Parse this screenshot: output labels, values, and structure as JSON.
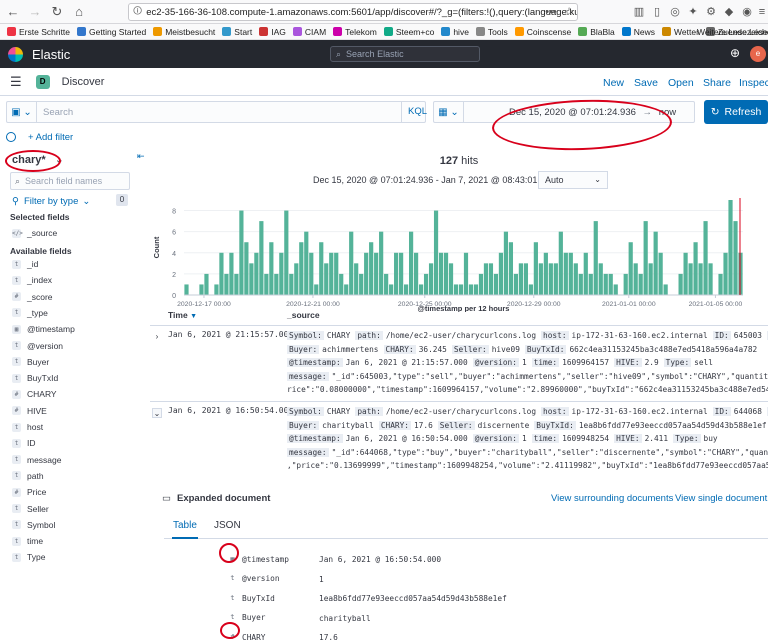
{
  "browser": {
    "url": "ec2-35-166-36-108.compute-1.amazonaws.com:5601/app/discover#/?_g=(filters:!(),query:(language:kue",
    "bookmarks": [
      "Erste Schritte",
      "Getting Started",
      "Meistbesucht",
      "Start",
      "IAG",
      "CIAM",
      "Telekom",
      "Steem+co",
      "hive",
      "Tools",
      "Coinscense",
      "BlaBla",
      "News",
      "Wetter",
      "Zuende Lesen"
    ],
    "other_bookmarks": "Weitere Lesezeichen"
  },
  "kibana": {
    "brand": "Elastic",
    "search_placeholder": "Search Elastic"
  },
  "app": {
    "badge": "D",
    "title": "Discover",
    "actions": [
      "New",
      "Save",
      "Open",
      "Share",
      "Inspect"
    ]
  },
  "query": {
    "placeholder": "Search",
    "language": "KQL",
    "range_start": "Dec 15, 2020 @ 07:01:24.936",
    "arrow": "→",
    "range_end": "now",
    "refresh": "Refresh",
    "add_filter": "+ Add filter"
  },
  "sidebar": {
    "index_pattern": "chary*",
    "field_search_placeholder": "Search field names",
    "filter_by_type": "Filter by type",
    "filter_count": "0",
    "selected_header": "Selected fields",
    "selected": [
      {
        "token": "</>",
        "name": "_source"
      }
    ],
    "available_header": "Available fields",
    "available": [
      {
        "token": "t",
        "name": "_id"
      },
      {
        "token": "t",
        "name": "_index"
      },
      {
        "token": "#",
        "name": "_score"
      },
      {
        "token": "t",
        "name": "_type"
      },
      {
        "token": "▦",
        "name": "@timestamp"
      },
      {
        "token": "t",
        "name": "@version"
      },
      {
        "token": "t",
        "name": "Buyer"
      },
      {
        "token": "t",
        "name": "BuyTxId"
      },
      {
        "token": "#",
        "name": "CHARY"
      },
      {
        "token": "#",
        "name": "HIVE"
      },
      {
        "token": "t",
        "name": "host"
      },
      {
        "token": "t",
        "name": "ID"
      },
      {
        "token": "t",
        "name": "message"
      },
      {
        "token": "t",
        "name": "path"
      },
      {
        "token": "#",
        "name": "Price"
      },
      {
        "token": "t",
        "name": "Seller"
      },
      {
        "token": "t",
        "name": "Symbol"
      },
      {
        "token": "t",
        "name": "time"
      },
      {
        "token": "t",
        "name": "Type"
      }
    ]
  },
  "results": {
    "hits_count": "127",
    "hits_label": "hits",
    "range": "Dec 15, 2020 @ 07:01:24.936 - Jan 7, 2021 @ 08:43:01.513",
    "interval": "Auto",
    "col_time": "Time",
    "col_source": "_source"
  },
  "chart_data": {
    "type": "bar",
    "title": "",
    "xlabel": "@timestamp per 12 hours",
    "ylabel": "Count",
    "ylim": [
      0,
      9
    ],
    "yticks": [
      0,
      2,
      4,
      6,
      8
    ],
    "xtick_labels": [
      "2020-12-17 00:00",
      "2020-12-21 00:00",
      "2020-12-25 00:00",
      "2020-12-29 00:00",
      "2021-01-01 00:00",
      "2021-01-05 00:00"
    ],
    "color": "#54b399",
    "values": [
      1,
      0,
      0,
      1,
      2,
      0,
      1,
      4,
      2,
      4,
      2,
      8,
      5,
      3,
      4,
      7,
      2,
      5,
      2,
      4,
      8,
      2,
      3,
      5,
      6,
      4,
      1,
      5,
      3,
      4,
      4,
      2,
      1,
      6,
      3,
      2,
      4,
      5,
      4,
      6,
      2,
      1,
      4,
      4,
      1,
      6,
      4,
      1,
      2,
      3,
      8,
      4,
      4,
      3,
      1,
      1,
      4,
      1,
      1,
      2,
      3,
      3,
      2,
      4,
      6,
      5,
      2,
      3,
      3,
      1,
      5,
      3,
      4,
      3,
      3,
      6,
      4,
      4,
      3,
      2,
      4,
      2,
      7,
      3,
      2,
      2,
      1,
      0,
      2,
      5,
      3,
      2,
      7,
      3,
      6,
      4,
      1,
      0,
      0,
      2,
      4,
      3,
      5,
      3,
      7,
      3,
      0,
      2,
      4,
      9,
      7,
      4
    ]
  },
  "rows": [
    {
      "time": "Jan 6, 2021 @ 21:15:57.000",
      "expander": "›",
      "pairs": [
        [
          [
            "Symbol:",
            "CHARY"
          ],
          [
            "path:",
            "/home/ec2-user/charycurlcons.log"
          ],
          [
            "host:",
            "ip-172-31-63-160.ec2.internal"
          ],
          [
            "ID:",
            "645003"
          ],
          [
            "Price:",
            "0.08"
          ]
        ],
        [
          [
            "Buyer:",
            "achimmertens"
          ],
          [
            "CHARY:",
            "36.245"
          ],
          [
            "Seller:",
            "hive09"
          ],
          [
            "BuyTxId:",
            "662c4ea31153245ba3c488e7ed5418a596a4a782"
          ]
        ],
        [
          [
            "@timestamp:",
            "Jan 6, 2021 @ 21:15:57.000"
          ],
          [
            "@version:",
            "1"
          ],
          [
            "time:",
            "1609964157"
          ],
          [
            "HIVE:",
            "2.9"
          ],
          [
            "Type:",
            "sell"
          ]
        ],
        [
          [
            "message:",
            "\"_id\":645003,\"type\":\"sell\",\"buyer\":\"achimmertens\",\"seller\":\"hive09\",\"symbol\":\"CHARY\",\"quantity\":\"36.245\",\"p"
          ]
        ]
      ],
      "extra": "rice\":\"0.08000000\",\"timestamp\":1609964157,\"volume\":\"2.89960000\",\"buyTxId\":\"662c4ea31153245ba3c488e7ed5418a596a4a782\","
    },
    {
      "time": "Jan 6, 2021 @ 16:50:54.000",
      "expander": "⌄",
      "pairs": [
        [
          [
            "Symbol:",
            "CHARY"
          ],
          [
            "path:",
            "/home/ec2-user/charycurlcons.log"
          ],
          [
            "host:",
            "ip-172-31-63-160.ec2.internal"
          ],
          [
            "ID:",
            "644068"
          ],
          [
            "Price:",
            "0.137"
          ]
        ],
        [
          [
            "Buyer:",
            "charityball"
          ],
          [
            "CHARY:",
            "17.6"
          ],
          [
            "Seller:",
            "discernente"
          ],
          [
            "BuyTxId:",
            "1ea8b6fdd77e93eeccd057aa54d59d43b588e1ef"
          ]
        ],
        [
          [
            "@timestamp:",
            "Jan 6, 2021 @ 16:50:54.000"
          ],
          [
            "@version:",
            "1"
          ],
          [
            "time:",
            "1609948254"
          ],
          [
            "HIVE:",
            "2.411"
          ],
          [
            "Type:",
            "buy"
          ]
        ],
        [
          [
            "message:",
            "\"_id\":644068,\"type\":\"buy\",\"buyer\":\"charityball\",\"seller\":\"discernente\",\"symbol\":\"CHARY\",\"quantity\":\"17.600\""
          ]
        ]
      ],
      "extra": ",\"price\":\"0.13699999\",\"timestamp\":1609948254,\"volume\":\"2.41119982\",\"buyTxId\":\"1ea8b6fdd77e93eeccd057aa54d59d43b588e1e"
    }
  ],
  "expanded": {
    "title": "Expanded document",
    "surrounding": "View surrounding documents",
    "single": "View single document",
    "tabs": [
      "Table",
      "JSON"
    ],
    "fields": [
      {
        "token": "▦",
        "name": "@timestamp",
        "value": "Jan 6, 2021 @ 16:50:54.000"
      },
      {
        "token": "t",
        "name": "@version",
        "value": "1"
      },
      {
        "token": "t",
        "name": "BuyTxId",
        "value": "1ea8b6fdd77e93eeccd057aa54d59d43b588e1ef"
      },
      {
        "token": "t",
        "name": "Buyer",
        "value": "charityball"
      },
      {
        "token": "#",
        "name": "CHARY",
        "value": "17.6"
      }
    ]
  }
}
